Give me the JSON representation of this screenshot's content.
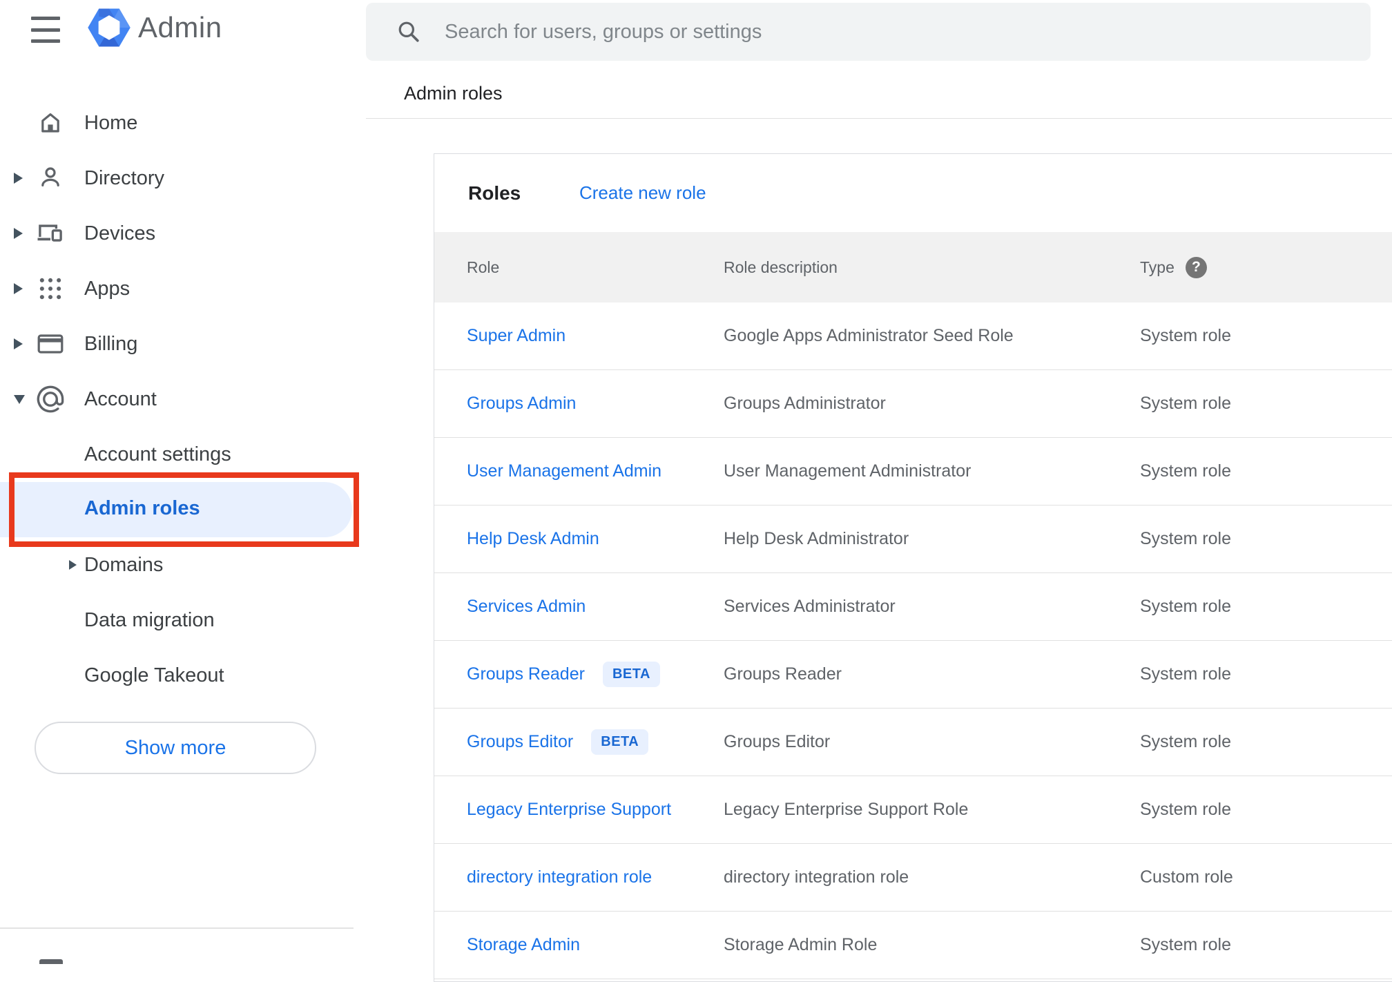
{
  "brand": {
    "app_name": "Admin"
  },
  "search": {
    "placeholder": "Search for users, groups or settings"
  },
  "page": {
    "title": "Admin roles"
  },
  "sidebar": {
    "items": [
      {
        "label": "Home"
      },
      {
        "label": "Directory"
      },
      {
        "label": "Devices"
      },
      {
        "label": "Apps"
      },
      {
        "label": "Billing"
      },
      {
        "label": "Account"
      }
    ],
    "account_submenu": [
      {
        "label": "Account settings"
      },
      {
        "label": "Admin roles"
      },
      {
        "label": "Domains"
      },
      {
        "label": "Data migration"
      },
      {
        "label": "Google Takeout"
      }
    ],
    "active_item": "Admin roles",
    "show_more_label": "Show more"
  },
  "roles_panel": {
    "title": "Roles",
    "create_link": "Create new role",
    "columns": {
      "role": "Role",
      "description": "Role description",
      "type": "Type"
    },
    "rows": [
      {
        "role": "Super Admin",
        "description": "Google Apps Administrator Seed Role",
        "type": "System role"
      },
      {
        "role": "Groups Admin",
        "description": "Groups Administrator",
        "type": "System role"
      },
      {
        "role": "User Management Admin",
        "description": "User Management Administrator",
        "type": "System role"
      },
      {
        "role": "Help Desk Admin",
        "description": "Help Desk Administrator",
        "type": "System role"
      },
      {
        "role": "Services Admin",
        "description": "Services Administrator",
        "type": "System role"
      },
      {
        "role": "Groups Reader",
        "badge": "BETA",
        "description": "Groups Reader",
        "type": "System role"
      },
      {
        "role": "Groups Editor",
        "badge": "BETA",
        "description": "Groups Editor",
        "type": "System role"
      },
      {
        "role": "Legacy Enterprise Support",
        "description": "Legacy Enterprise Support Role",
        "type": "System role"
      },
      {
        "role": "directory integration role",
        "description": "directory integration role",
        "type": "Custom role"
      },
      {
        "role": "Storage Admin",
        "description": "Storage Admin Role",
        "type": "System role"
      }
    ]
  },
  "colors": {
    "link_blue": "#1a73e8",
    "active_nav_blue": "#1967d2",
    "active_pill_bg": "#e8f0fe",
    "annotation_red": "#e8391c",
    "table_header_bg": "#f1f1f1"
  }
}
